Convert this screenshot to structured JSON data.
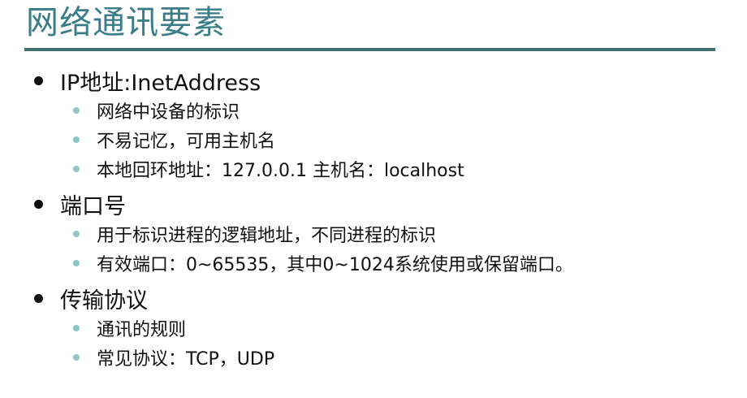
{
  "slide": {
    "title": "网络通讯要素",
    "colors": {
      "title": "#3a7d88",
      "rule": "#3f6f74",
      "sub_bullet": "#8fc4c8",
      "text": "#111111"
    },
    "sections": [
      {
        "heading": "IP地址:InetAddress",
        "items": [
          "网络中设备的标识",
          "不易记忆，可用主机名",
          "本地回环地址：127.0.0.1  主机名：localhost"
        ]
      },
      {
        "heading": "端口号",
        "items": [
          "用于标识进程的逻辑地址，不同进程的标识",
          "有效端口：0~65535，其中0~1024系统使用或保留端口。"
        ]
      },
      {
        "heading": "传输协议",
        "items": [
          "通讯的规则",
          "常见协议：TCP，UDP"
        ]
      }
    ]
  }
}
